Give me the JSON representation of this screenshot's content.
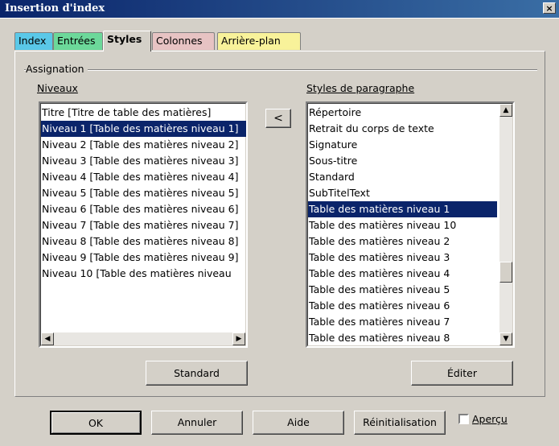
{
  "window": {
    "title": "Insertion d'index",
    "close_glyph": "×"
  },
  "tabs": [
    {
      "label": "Index",
      "color": "#5ac8e8"
    },
    {
      "label": "Entrées",
      "color": "#6cd89a"
    },
    {
      "label": "Styles",
      "color": "#d4d0c8"
    },
    {
      "label": "Colonnes",
      "color": "#e7c3c3"
    },
    {
      "label": "Arrière-plan",
      "color": "#f8f29a"
    }
  ],
  "assignation": {
    "group_label": "Assignation",
    "levels_label": "Niveaux",
    "levels": [
      "Titre [Titre de table des matières]",
      "Niveau 1 [Table des matières niveau 1]",
      "Niveau 2 [Table des matières niveau 2]",
      "Niveau 3 [Table des matières niveau 3]",
      "Niveau 4 [Table des matières niveau 4]",
      "Niveau 5 [Table des matières niveau 5]",
      "Niveau 6 [Table des matières niveau 6]",
      "Niveau 7 [Table des matières niveau 7]",
      "Niveau 8 [Table des matières niveau 8]",
      "Niveau 9 [Table des matières niveau 9]",
      "Niveau 10 [Table des matières niveau"
    ],
    "levels_selected": 1,
    "assign_button": "<",
    "styles_label": "Styles de paragraphe",
    "styles": [
      "Répertoire",
      "Retrait du corps de texte",
      "Signature",
      "Sous-titre",
      "Standard",
      "SubTitelText",
      "Table des matières niveau 1",
      "Table des matières niveau 10",
      "Table des matières niveau 2",
      "Table des matières niveau 3",
      "Table des matières niveau 4",
      "Table des matières niveau 5",
      "Table des matières niveau 6",
      "Table des matières niveau 7",
      "Table des matières niveau 8"
    ],
    "styles_selected": 6,
    "standard_button": "Standard",
    "edit_button": "Éditer"
  },
  "footer": {
    "ok": "OK",
    "cancel": "Annuler",
    "help": "Aide",
    "reset": "Réinitialisation",
    "preview_label": "Aperçu",
    "preview_checked": false
  },
  "icons": {
    "scroll_left": "◀",
    "scroll_right": "▶",
    "scroll_up": "▲",
    "scroll_down": "▼"
  }
}
